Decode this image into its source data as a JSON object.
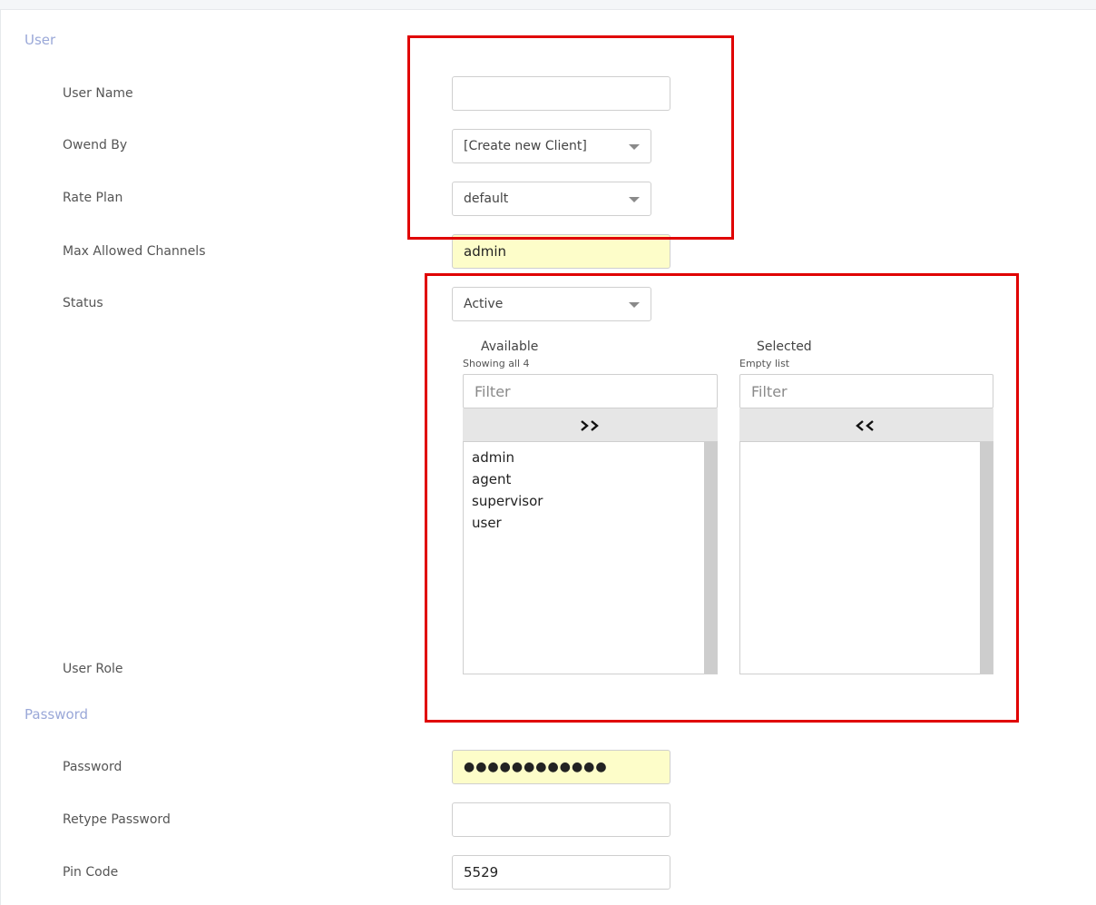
{
  "sections": {
    "user": "User",
    "password": "Password"
  },
  "fields": {
    "user_name": {
      "label": "User Name",
      "value": ""
    },
    "owned_by": {
      "label": "Owend By",
      "value": "[Create new Client]"
    },
    "rate_plan": {
      "label": "Rate Plan",
      "value": "default"
    },
    "max_channels": {
      "label": "Max Allowed Channels",
      "value": "admin"
    },
    "status": {
      "label": "Status",
      "value": "Active"
    },
    "user_role": {
      "label": "User Role"
    },
    "password": {
      "label": "Password",
      "value": "●●●●●●●●●●●●"
    },
    "retype_password": {
      "label": "Retype Password",
      "value": ""
    },
    "pin_code": {
      "label": "Pin Code",
      "value": "5529"
    }
  },
  "dual_list": {
    "available": {
      "title": "Available",
      "info": "Showing all 4",
      "filter_placeholder": "Filter",
      "items": [
        "admin",
        "agent",
        "supervisor",
        "user"
      ]
    },
    "selected": {
      "title": "Selected",
      "info": "Empty list",
      "filter_placeholder": "Filter",
      "items": []
    }
  },
  "icons": {
    "move_all_right": "chevron-double-right-icon",
    "move_all_left": "chevron-double-left-icon",
    "dropdown": "caret-down-icon"
  },
  "colors": {
    "section_title": "#9aa8d8",
    "autofill_background": "#fdfdc9",
    "annotation_border": "#e00000",
    "move_button_background": "#e6e6e6"
  }
}
